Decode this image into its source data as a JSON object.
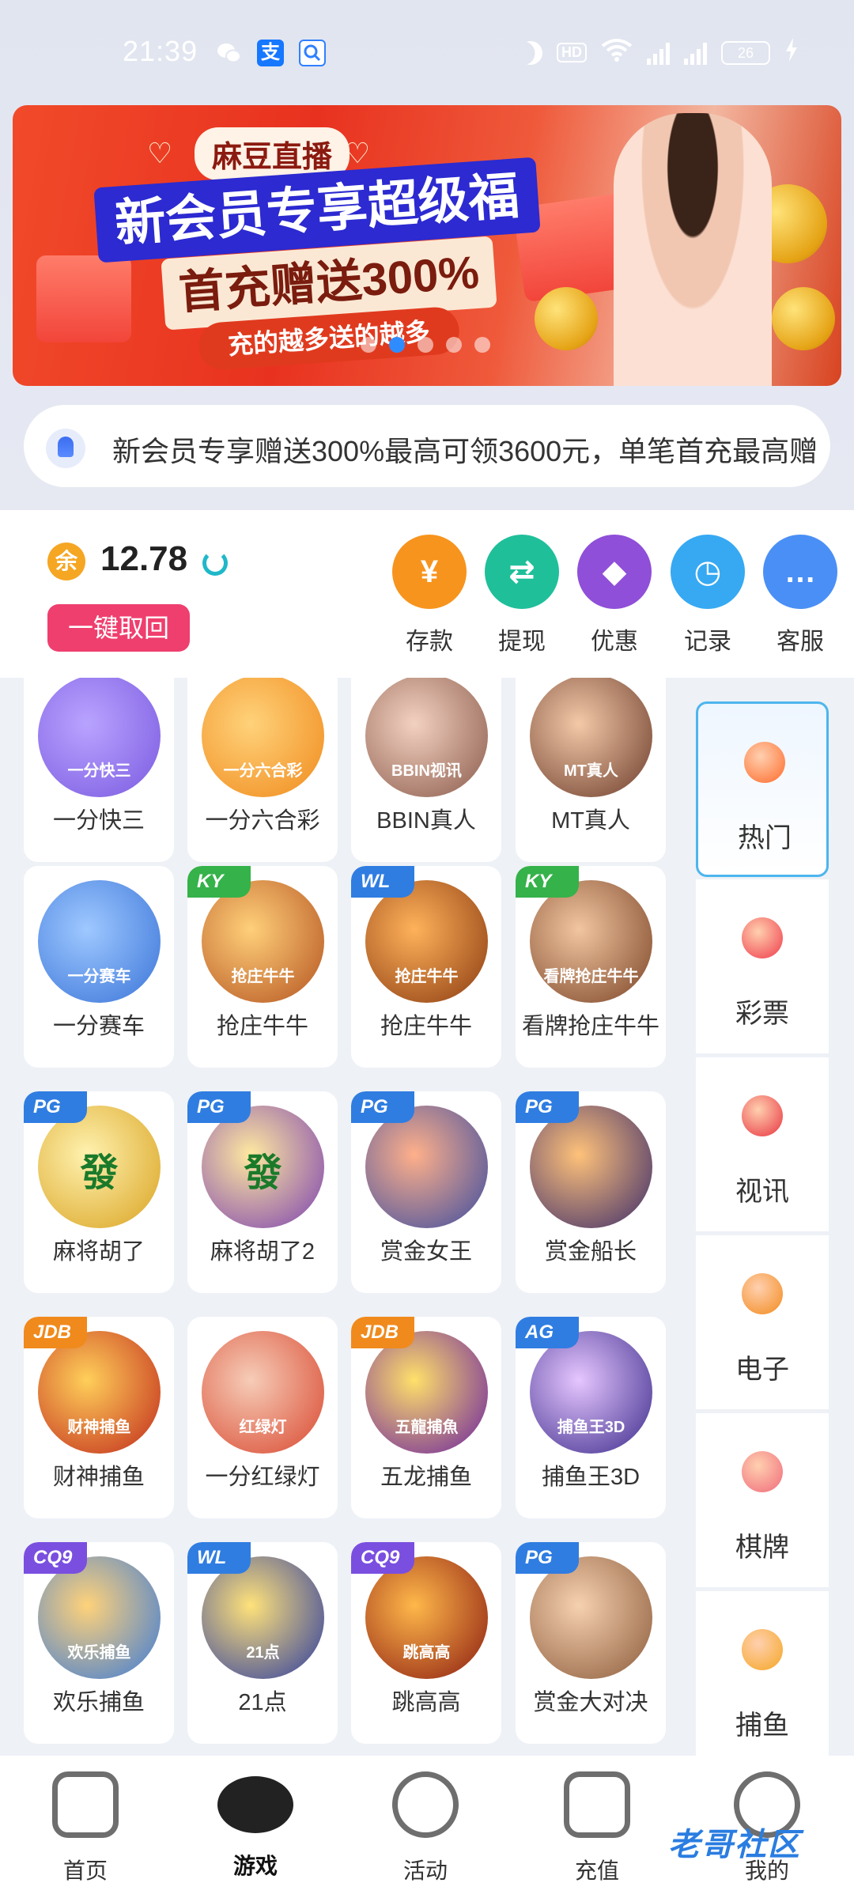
{
  "status_bar": {
    "time": "21:39",
    "icons": [
      "wechat-icon",
      "alipay-icon",
      "search-app-icon",
      "moon-icon",
      "hd-icon",
      "wifi-icon",
      "signal-5g-icon",
      "signal-5g-icon",
      "battery-icon",
      "charging-icon"
    ],
    "hd_label": "HD",
    "battery": "26"
  },
  "banner": {
    "brand": "麻豆直播",
    "line1": "新会员专享超级福利",
    "line2": "首充赠送300%",
    "line3": "充的越多送的越多",
    "dots": 5,
    "active_dot": 1
  },
  "marquee": {
    "text": "新会员专享赠送300%最高可领3600元，单笔首充最高赠"
  },
  "wallet": {
    "currency_icon_label": "余",
    "balance": "12.78",
    "withdraw_all_label": "一键取回"
  },
  "actions": [
    {
      "label": "存款",
      "icon": "yen-icon",
      "color": "#f7941d",
      "glyph": "¥"
    },
    {
      "label": "提现",
      "icon": "transfer-icon",
      "color": "#1fbf9a",
      "glyph": "⇄"
    },
    {
      "label": "优惠",
      "icon": "tag-icon",
      "color": "#8f4fd8",
      "glyph": "◆"
    },
    {
      "label": "记录",
      "icon": "clock-icon",
      "color": "#36a9f2",
      "glyph": "◷"
    },
    {
      "label": "客服",
      "icon": "chat-icon",
      "color": "#4a8ff5",
      "glyph": "…"
    }
  ],
  "games": [
    {
      "name": "一分快三",
      "tag": "",
      "thumb_text": "一分快三"
    },
    {
      "name": "一分六合彩",
      "tag": "",
      "thumb_text": "一分六合彩"
    },
    {
      "name": "BBIN真人",
      "tag": "",
      "thumb_text": "BBIN视讯"
    },
    {
      "name": "MT真人",
      "tag": "",
      "thumb_text": "MT真人"
    },
    {
      "name": "一分赛车",
      "tag": "",
      "thumb_text": "一分赛车"
    },
    {
      "name": "抢庄牛牛",
      "tag": "KY",
      "thumb_text": "抢庄牛牛"
    },
    {
      "name": "抢庄牛牛",
      "tag": "WL",
      "thumb_text": "抢庄牛牛"
    },
    {
      "name": "看牌抢庄牛牛",
      "tag": "KY",
      "thumb_text": "看牌抢庄牛牛"
    },
    {
      "name": "麻将胡了",
      "tag": "PG",
      "thumb_text": "發"
    },
    {
      "name": "麻将胡了2",
      "tag": "PG",
      "thumb_text": "發"
    },
    {
      "name": "赏金女王",
      "tag": "PG",
      "thumb_text": ""
    },
    {
      "name": "赏金船长",
      "tag": "PG",
      "thumb_text": ""
    },
    {
      "name": "财神捕鱼",
      "tag": "JDB",
      "thumb_text": "财神捕鱼"
    },
    {
      "name": "一分红绿灯",
      "tag": "",
      "thumb_text": "红绿灯"
    },
    {
      "name": "五龙捕鱼",
      "tag": "JDB",
      "thumb_text": "五龍捕魚"
    },
    {
      "name": "捕鱼王3D",
      "tag": "AG",
      "thumb_text": "捕鱼王3D"
    },
    {
      "name": "欢乐捕鱼",
      "tag": "CQ9",
      "thumb_text": "欢乐捕鱼"
    },
    {
      "name": "21点",
      "tag": "WL",
      "thumb_text": "21点"
    },
    {
      "name": "跳高高",
      "tag": "CQ9",
      "thumb_text": "跳高高"
    },
    {
      "name": "赏金大对决",
      "tag": "PG",
      "thumb_text": ""
    }
  ],
  "tag_colors": {
    "KY": "#35b24a",
    "WL": "#2f7de1",
    "PG": "#2f7de1",
    "JDB": "#f08a1c",
    "AG": "#2f7de1",
    "CQ9": "#7a4fe0"
  },
  "categories": [
    {
      "label": "热门",
      "icon": "fire-icon",
      "active": true
    },
    {
      "label": "彩票",
      "icon": "lottery-ball-icon",
      "active": false
    },
    {
      "label": "视讯",
      "icon": "chip-icon",
      "active": false
    },
    {
      "label": "电子",
      "icon": "slot-seven-icon",
      "active": false
    },
    {
      "label": "棋牌",
      "icon": "cards-icon",
      "active": false
    },
    {
      "label": "捕鱼",
      "icon": "fish-icon",
      "active": false
    }
  ],
  "bottom_nav": [
    {
      "label": "首页",
      "icon": "home-icon",
      "active": false
    },
    {
      "label": "游戏",
      "icon": "gamepad-icon",
      "active": true
    },
    {
      "label": "活动",
      "icon": "flag-icon",
      "active": false
    },
    {
      "label": "充值",
      "icon": "wallet-icon",
      "active": false
    },
    {
      "label": "我的",
      "icon": "profile-icon",
      "active": false
    }
  ],
  "watermark": "老哥社区"
}
